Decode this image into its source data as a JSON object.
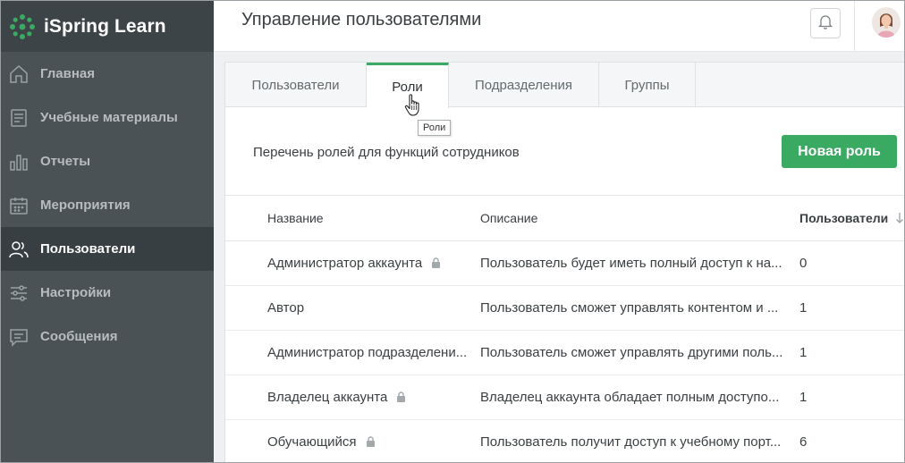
{
  "app": {
    "name": "iSpring Learn"
  },
  "sidebar": {
    "items": [
      {
        "label": "Главная",
        "icon": "home-icon",
        "active": false
      },
      {
        "label": "Учебные материалы",
        "icon": "courses-icon",
        "active": false
      },
      {
        "label": "Отчеты",
        "icon": "reports-icon",
        "active": false
      },
      {
        "label": "Мероприятия",
        "icon": "calendar-icon",
        "active": false
      },
      {
        "label": "Пользователи",
        "icon": "users-icon",
        "active": true
      },
      {
        "label": "Настройки",
        "icon": "settings-icon",
        "active": false
      },
      {
        "label": "Сообщения",
        "icon": "messages-icon",
        "active": false
      }
    ]
  },
  "header": {
    "title": "Управление пользователями"
  },
  "tabs": [
    {
      "label": "Пользователи",
      "active": false
    },
    {
      "label": "Роли",
      "active": true
    },
    {
      "label": "Подразделения",
      "active": false
    },
    {
      "label": "Группы",
      "active": false
    }
  ],
  "tooltip": {
    "text": "Роли"
  },
  "main": {
    "subtitle": "Перечень ролей для функций сотрудников",
    "new_role_label": "Новая роль"
  },
  "table": {
    "headers": {
      "name": "Название",
      "description": "Описание",
      "users": "Пользователи"
    },
    "rows": [
      {
        "name": "Администратор аккаунта",
        "locked": true,
        "description": "Пользователь будет иметь полный доступ к на...",
        "users": "0"
      },
      {
        "name": "Автор",
        "locked": false,
        "description": "Пользователь сможет управлять контентом и ...",
        "users": "1"
      },
      {
        "name": "Администратор подразделени...",
        "locked": false,
        "description": "Пользователь сможет управлять другими поль...",
        "users": "1"
      },
      {
        "name": "Владелец аккаунта",
        "locked": true,
        "description": "Владелец аккаунта обладает полным доступо...",
        "users": "1"
      },
      {
        "name": "Обучающийся",
        "locked": true,
        "description": "Пользователь получит доступ к учебному порт...",
        "users": "6"
      }
    ]
  },
  "colors": {
    "accent": "#3aaa62",
    "sidebar": "#4a5256",
    "sidebar_active": "#383f43"
  }
}
